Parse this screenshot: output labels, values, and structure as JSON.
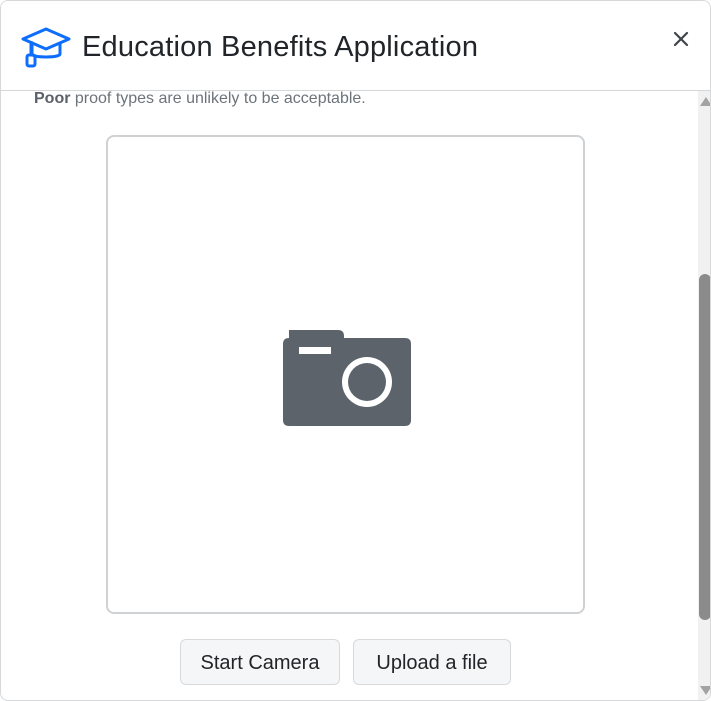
{
  "dialog": {
    "title": "Education Benefits Application",
    "icon": "graduation-cap-icon",
    "close_icon": "close-icon",
    "accent_color": "#0d6efd"
  },
  "note": {
    "bold": "Poor",
    "rest": " proof types are unlikely to be acceptable."
  },
  "preview": {
    "icon": "camera-icon",
    "icon_color": "#5c636a"
  },
  "actions": {
    "start_camera": "Start Camera",
    "upload_file": "Upload a file"
  }
}
